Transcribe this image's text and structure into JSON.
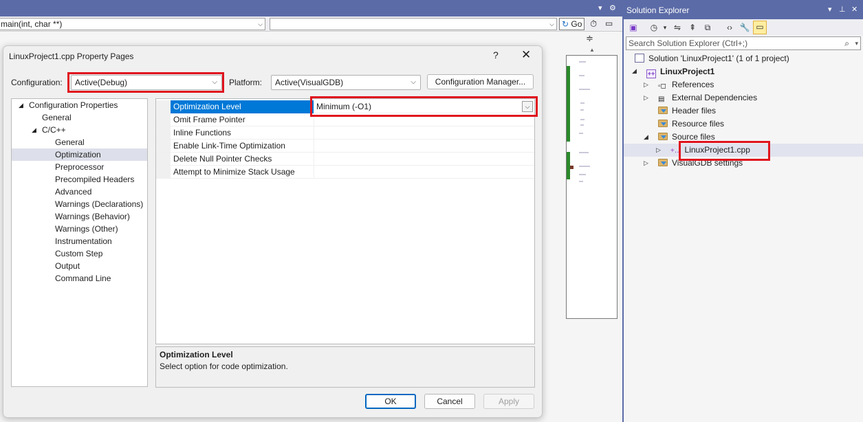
{
  "ide": {
    "function_combo": "main(int, char **)",
    "member_combo": "",
    "go_label": "Go"
  },
  "dialog": {
    "title": "LinuxProject1.cpp Property Pages",
    "help": "?",
    "close": "✕",
    "configuration_label": "Configuration:",
    "configuration_value": "Active(Debug)",
    "platform_label": "Platform:",
    "platform_value": "Active(VisualGDB)",
    "config_manager_label": "Configuration Manager...",
    "tree": [
      {
        "label": "Configuration Properties",
        "level": 0,
        "expander": "◢"
      },
      {
        "label": "General",
        "level": 1,
        "expander": ""
      },
      {
        "label": "C/C++",
        "level": 1,
        "expander": "◢"
      },
      {
        "label": "General",
        "level": 2,
        "expander": ""
      },
      {
        "label": "Optimization",
        "level": 2,
        "expander": "",
        "selected": true
      },
      {
        "label": "Preprocessor",
        "level": 2,
        "expander": ""
      },
      {
        "label": "Precompiled Headers",
        "level": 2,
        "expander": ""
      },
      {
        "label": "Advanced",
        "level": 2,
        "expander": ""
      },
      {
        "label": "Warnings (Declarations)",
        "level": 2,
        "expander": ""
      },
      {
        "label": "Warnings (Behavior)",
        "level": 2,
        "expander": ""
      },
      {
        "label": "Warnings (Other)",
        "level": 2,
        "expander": ""
      },
      {
        "label": "Instrumentation",
        "level": 2,
        "expander": ""
      },
      {
        "label": "Custom Step",
        "level": 2,
        "expander": ""
      },
      {
        "label": "Output",
        "level": 2,
        "expander": ""
      },
      {
        "label": "Command Line",
        "level": 2,
        "expander": ""
      }
    ],
    "properties": [
      {
        "name": "Optimization Level",
        "value": "Minimum (-O1)",
        "selected": true
      },
      {
        "name": "Omit Frame Pointer",
        "value": ""
      },
      {
        "name": "Inline Functions",
        "value": ""
      },
      {
        "name": "Enable Link-Time Optimization",
        "value": ""
      },
      {
        "name": "Delete Null Pointer Checks",
        "value": ""
      },
      {
        "name": "Attempt to Minimize Stack Usage",
        "value": ""
      }
    ],
    "description_title": "Optimization Level",
    "description_text": "Select option for code optimization.",
    "ok_label": "OK",
    "cancel_label": "Cancel",
    "apply_label": "Apply"
  },
  "solution_explorer": {
    "title": "Solution Explorer",
    "search_placeholder": "Search Solution Explorer (Ctrl+;)",
    "items": [
      {
        "label": "Solution 'LinuxProject1' (1 of 1 project)",
        "icon": "solution-icon"
      },
      {
        "label": "LinuxProject1",
        "icon": "project-icon",
        "bold": true
      },
      {
        "label": "References",
        "icon": "references-icon"
      },
      {
        "label": "External Dependencies",
        "icon": "external-deps-icon"
      },
      {
        "label": "Header files",
        "icon": "filter-folder-icon"
      },
      {
        "label": "Resource files",
        "icon": "filter-folder-icon"
      },
      {
        "label": "Source files",
        "icon": "filter-folder-icon"
      },
      {
        "label": "LinuxProject1.cpp",
        "icon": "cpp-file-icon"
      },
      {
        "label": "VisualGDB settings",
        "icon": "filter-folder-icon"
      }
    ]
  },
  "colors": {
    "titlebar": "#5b6ba7",
    "highlight": "#e0141e",
    "selection": "#0078d7"
  }
}
